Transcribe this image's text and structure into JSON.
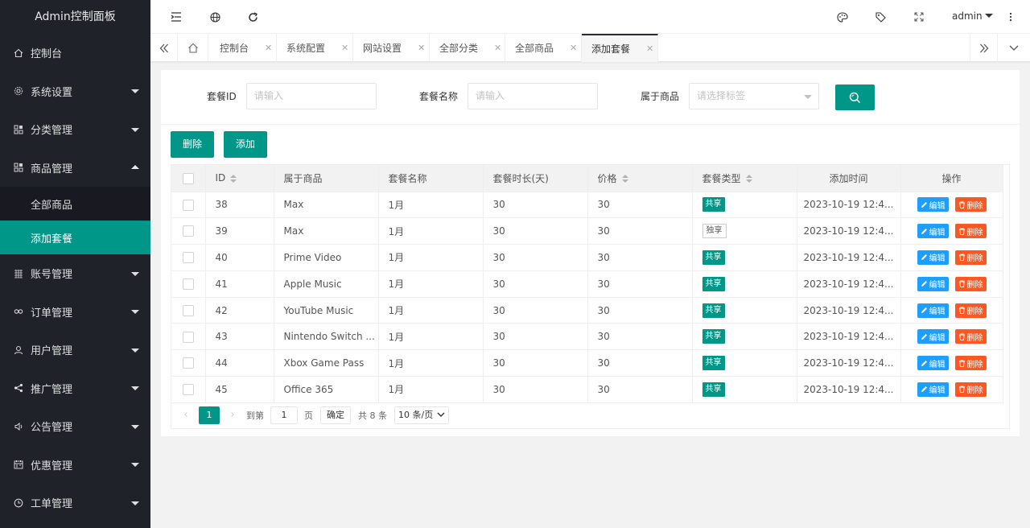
{
  "app": {
    "title": "Admin控制面板"
  },
  "sidebar": {
    "items": [
      {
        "label": "控制台",
        "icon": "home-icon",
        "arrow": ""
      },
      {
        "label": "系统设置",
        "icon": "gear-icon",
        "arrow": "down"
      },
      {
        "label": "分类管理",
        "icon": "apps-icon",
        "arrow": "down"
      },
      {
        "label": "商品管理",
        "icon": "apps-icon",
        "arrow": "up"
      },
      {
        "label": "账号管理",
        "icon": "list-icon",
        "arrow": "down"
      },
      {
        "label": "订单管理",
        "icon": "link-icon",
        "arrow": "down"
      },
      {
        "label": "用户管理",
        "icon": "user-icon",
        "arrow": "down"
      },
      {
        "label": "推广管理",
        "icon": "share-icon",
        "arrow": "down"
      },
      {
        "label": "公告管理",
        "icon": "speaker-icon",
        "arrow": "down"
      },
      {
        "label": "优惠管理",
        "icon": "calendar-icon",
        "arrow": "down"
      },
      {
        "label": "工单管理",
        "icon": "clock-icon",
        "arrow": "down"
      }
    ],
    "sub_items": [
      {
        "label": "全部商品",
        "active": false
      },
      {
        "label": "添加套餐",
        "active": true
      }
    ]
  },
  "header": {
    "user": "admin"
  },
  "tabs": [
    {
      "label": "控制台"
    },
    {
      "label": "系统配置"
    },
    {
      "label": "网站设置"
    },
    {
      "label": "全部分类"
    },
    {
      "label": "全部商品"
    },
    {
      "label": "添加套餐",
      "active": true
    }
  ],
  "search": {
    "id_label": "套餐ID",
    "id_placeholder": "请输入",
    "name_label": "套餐名称",
    "name_placeholder": "请输入",
    "product_label": "属于商品",
    "product_placeholder": "请选择标签"
  },
  "toolbar": {
    "delete_label": "删除",
    "add_label": "添加"
  },
  "table": {
    "columns": [
      "ID",
      "属于商品",
      "套餐名称",
      "套餐时长(天)",
      "价格",
      "套餐类型",
      "添加时间",
      "操作"
    ],
    "edit_label": "编辑",
    "delete_label": "删除",
    "rows": [
      {
        "id": "38",
        "product": "Max",
        "name": "1月",
        "duration": "30",
        "price": "30",
        "type": "共享",
        "shared": true,
        "time": "2023-10-19 12:4..."
      },
      {
        "id": "39",
        "product": "Max",
        "name": "1月",
        "duration": "30",
        "price": "30",
        "type": "独享",
        "shared": false,
        "time": "2023-10-19 12:4..."
      },
      {
        "id": "40",
        "product": "Prime Video",
        "name": "1月",
        "duration": "30",
        "price": "30",
        "type": "共享",
        "shared": true,
        "time": "2023-10-19 12:4..."
      },
      {
        "id": "41",
        "product": "Apple Music",
        "name": "1月",
        "duration": "30",
        "price": "30",
        "type": "共享",
        "shared": true,
        "time": "2023-10-19 12:4..."
      },
      {
        "id": "42",
        "product": "YouTube Music",
        "name": "1月",
        "duration": "30",
        "price": "30",
        "type": "共享",
        "shared": true,
        "time": "2023-10-19 12:4..."
      },
      {
        "id": "43",
        "product": "Nintendo Switch ...",
        "name": "1月",
        "duration": "30",
        "price": "30",
        "type": "共享",
        "shared": true,
        "time": "2023-10-19 12:4..."
      },
      {
        "id": "44",
        "product": "Xbox Game Pass",
        "name": "1月",
        "duration": "30",
        "price": "30",
        "type": "共享",
        "shared": true,
        "time": "2023-10-19 12:4..."
      },
      {
        "id": "45",
        "product": "Office 365",
        "name": "1月",
        "duration": "30",
        "price": "30",
        "type": "共享",
        "shared": true,
        "time": "2023-10-19 12:4..."
      }
    ]
  },
  "pagination": {
    "current": "1",
    "goto_label": "到第",
    "goto_value": "1",
    "page_unit": "页",
    "confirm_label": "确定",
    "total_label": "共 8 条",
    "page_size": "10 条/页"
  },
  "colors": {
    "accent": "#009688",
    "sidebar_bg": "#20222a",
    "edit": "#1e9fff",
    "delete": "#ff5722"
  }
}
